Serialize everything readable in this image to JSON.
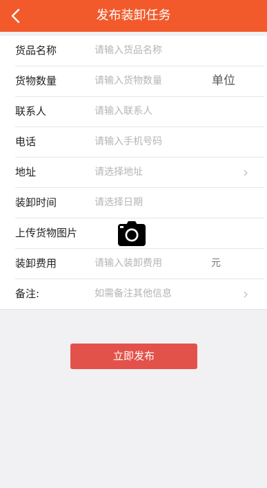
{
  "header": {
    "title": "发布装卸任务"
  },
  "form": {
    "goods_name": {
      "label": "货品名称",
      "placeholder": "请输入货品名称"
    },
    "goods_quantity": {
      "label": "货物数量",
      "placeholder": "请输入货物数量",
      "unit": "单位"
    },
    "contact": {
      "label": "联系人",
      "placeholder": "请输入联系人"
    },
    "phone": {
      "label": "电话",
      "placeholder": "请输入手机号码"
    },
    "address": {
      "label": "地址",
      "placeholder": "请选择地址"
    },
    "load_time": {
      "label": "装卸时间",
      "placeholder": "请选择日期"
    },
    "photo": {
      "label": "上传货物图片"
    },
    "fee": {
      "label": "装卸费用",
      "placeholder": "请输入装卸费用",
      "unit": "元"
    },
    "remark": {
      "label": "备注:",
      "placeholder": "如需备注其他信息"
    }
  },
  "actions": {
    "publish_label": "立即发布"
  },
  "colors": {
    "header_bg": "#f25a2b",
    "button_bg": "#e3524a",
    "page_bg": "#f1f1f3"
  },
  "icons": {
    "back": "chevron-left-icon",
    "camera": "camera-icon",
    "more": "chevron-right-icon"
  }
}
